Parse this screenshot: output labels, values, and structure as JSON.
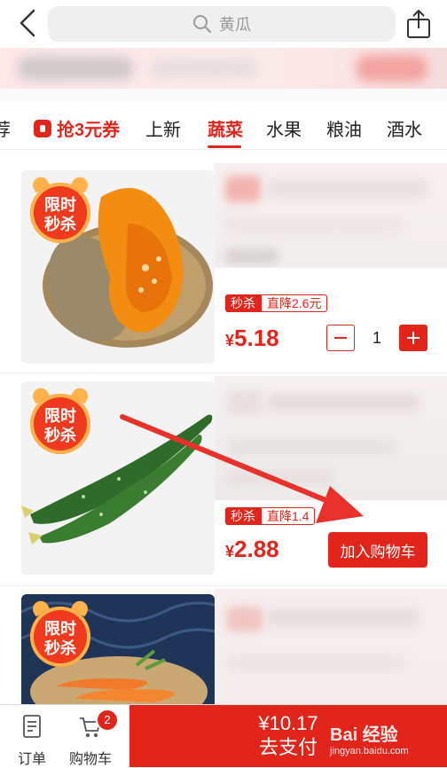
{
  "search": {
    "placeholder": "黄瓜"
  },
  "tabs": [
    {
      "label": "荐"
    },
    {
      "label": "抢3元券"
    },
    {
      "label": "上新"
    },
    {
      "label": "蔬菜"
    },
    {
      "label": "水果"
    },
    {
      "label": "粮油"
    },
    {
      "label": "酒水"
    }
  ],
  "active_tab": "蔬菜",
  "badge_text": {
    "line1": "限时",
    "line2": "秒杀"
  },
  "products": [
    {
      "image": "pumpkin",
      "tag": "秒杀",
      "discount": "直降2.6元",
      "currency": "¥",
      "price": "5.18",
      "quantity": "1"
    },
    {
      "image": "cucumber",
      "tag": "秒杀",
      "discount": "直降1.4",
      "currency": "¥",
      "price": "2.88",
      "button": "加入购物车"
    },
    {
      "image": "carrot"
    }
  ],
  "bottom_bar": {
    "orders_label": "订单",
    "cart_label": "购物车",
    "cart_count": "2",
    "pay_amount": "¥10.17",
    "pay_label": "去支付"
  },
  "watermark": {
    "brand": "Bai 经验",
    "url": "jingyan.baidu.com"
  },
  "colors": {
    "accent": "#e1251b",
    "badge_orange": "#ffb24a",
    "search_bg": "#efefef"
  }
}
